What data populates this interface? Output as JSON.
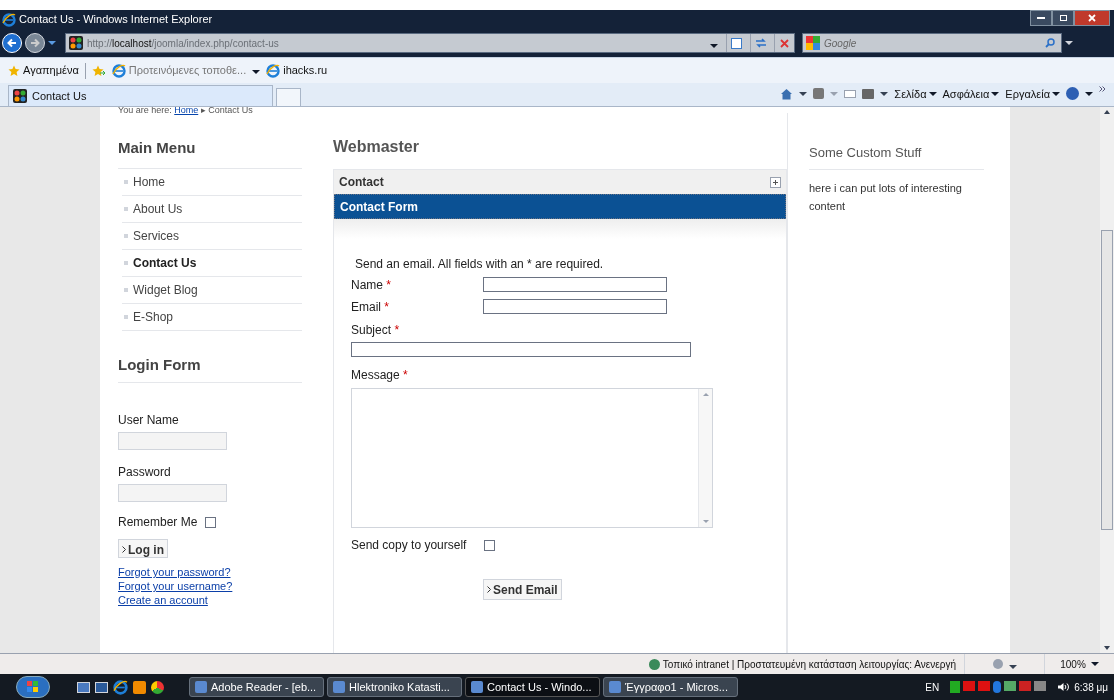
{
  "browser": {
    "title": "Contact Us - Windows Internet Explorer",
    "address": {
      "prefix": "http://",
      "host": "localhost",
      "path": "/joomla/index.php/contact-us"
    },
    "search_placeholder": "Google",
    "favorites_bar": {
      "favorites": "Αγαπημένα",
      "items": [
        "Προτεινόμενες τοποθε...",
        "ihacks.ru"
      ]
    },
    "tabs": [
      {
        "label": "Contact Us",
        "selected": true
      }
    ],
    "command_bar": [
      "Σελίδα",
      "Ασφάλεια",
      "Εργαλεία"
    ]
  },
  "page": {
    "breadcrumb": {
      "prefix": "You are here:",
      "link": "Home",
      "separator": "▸",
      "current": "Contact Us"
    },
    "main_menu": {
      "title": "Main Menu",
      "items": [
        {
          "label": "Home",
          "selected": false
        },
        {
          "label": "About Us",
          "selected": false
        },
        {
          "label": "Services",
          "selected": false
        },
        {
          "label": "Contact Us",
          "selected": true
        },
        {
          "label": "Widget Blog",
          "selected": false
        },
        {
          "label": "E-Shop",
          "selected": false
        }
      ]
    },
    "login_form": {
      "title": "Login Form",
      "username_label": "User Name",
      "password_label": "Password",
      "remember_me": {
        "label": "Remember Me",
        "checked": false
      },
      "login_button": "Log in",
      "links": [
        "Forgot your password?",
        "Forgot your username?",
        "Create an account"
      ]
    },
    "content": {
      "heading": "Webmaster",
      "panels": [
        {
          "label": "Contact",
          "selected": false
        },
        {
          "label": "Contact Form",
          "selected": true
        }
      ],
      "form": {
        "intro": "Send an email. All fields with an * are required.",
        "required_mark": "*",
        "fields": [
          {
            "label": "Name",
            "required": true,
            "kind": "short"
          },
          {
            "label": "Email",
            "required": true,
            "kind": "short"
          },
          {
            "label": "Subject",
            "required": true,
            "kind": "long"
          },
          {
            "label": "Message",
            "required": true,
            "kind": "textarea"
          }
        ],
        "send_copy": {
          "label": "Send copy to yourself",
          "checked": false
        },
        "submit": "Send Email"
      }
    },
    "sidebar": {
      "title": "Some Custom Stuff",
      "text": "here i can put lots of interesting content"
    }
  },
  "status_bar": {
    "text": "Τοπικό intranet | Προστατευμένη κατάσταση λειτουργίας: Ανενεργή",
    "zoom": "100%"
  },
  "taskbar": {
    "buttons": [
      {
        "label": "Adobe Reader - [eb...",
        "selected": false
      },
      {
        "label": "Hlektroniko Katasti...",
        "selected": false
      },
      {
        "label": "Contact Us - Windo...",
        "selected": true
      },
      {
        "label": "Έγγραφο1 - Micros...",
        "selected": false
      }
    ],
    "language": "EN",
    "clock": "6:38 μμ"
  }
}
